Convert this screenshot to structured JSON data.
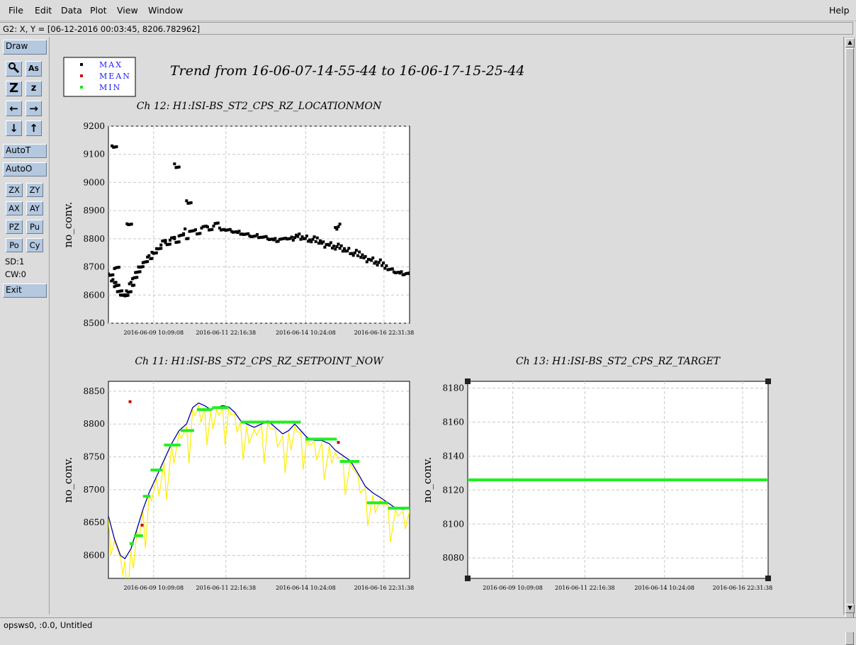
{
  "menu": {
    "file": "File",
    "edit": "Edit",
    "data": "Data",
    "plot": "Plot",
    "view": "View",
    "window": "Window",
    "help": "Help"
  },
  "status": {
    "coords": "G2: X, Y = [06-12-2016 00:03:45, 8206.782962]"
  },
  "toolbar": {
    "draw": "Draw",
    "autot": "AutoT",
    "autoo": "AutoO",
    "zx": "ZX",
    "zy": "ZY",
    "ax": "AX",
    "ay": "AY",
    "pz": "PZ",
    "pu": "Pu",
    "po": "Po",
    "cy": "Cy",
    "sd": "SD:1",
    "cw": "CW:0",
    "exit": "Exit",
    "icons": {
      "pointer": "magnify-icon",
      "text": "text-as-icon",
      "zoom_in": "zoom-in-z-icon",
      "zoom_out": "zoom-out-z-icon",
      "left": "left-arrow-icon",
      "right": "right-arrow-icon",
      "down": "down-arrow-icon",
      "up": "up-arrow-icon"
    }
  },
  "bottom": {
    "label": "opsws0, :0.0, Untitled"
  },
  "page": {
    "title": "Trend from 16-06-07-14-55-44 to 16-06-17-15-25-44",
    "legend": [
      {
        "label": "MAX",
        "color": "#000000"
      },
      {
        "label": "MEAN",
        "color": "#d00000"
      },
      {
        "label": "MIN",
        "color": "#20e020"
      }
    ],
    "colors": {
      "max": "#000000",
      "mean": "#d00000",
      "min": "#22ee22",
      "curve": "#0000a0",
      "band": "#ffee00"
    }
  },
  "chart_data": [
    {
      "type": "scatter",
      "title": "Ch 12: H1:ISI-BS_ST2_CPS_RZ_LOCATIONMON",
      "ylabel": "no_conv.",
      "xlabel": "",
      "ylim": [
        8500,
        9200
      ],
      "yticks": [
        "8500",
        "8600",
        "8700",
        "8800",
        "8900",
        "9000",
        "9100",
        "9200"
      ],
      "xticks": [
        "2016-06-09 10:09:08",
        "2016-06-11 22:16:38",
        "2016-06-14 10:24:08",
        "2016-06-16 22:31:38"
      ],
      "xrange_days": [
        0,
        10.02
      ],
      "grid": true,
      "series": [
        {
          "name": "MAX",
          "points": [
            [
              0.0,
              8675
            ],
            [
              0.1,
              8650
            ],
            [
              0.2,
              8630
            ],
            [
              0.3,
              8612
            ],
            [
              0.4,
              8600
            ],
            [
              0.5,
              8600
            ],
            [
              0.6,
              8615
            ],
            [
              0.7,
              8640
            ],
            [
              0.8,
              8658
            ],
            [
              0.9,
              8680
            ],
            [
              1.0,
              8700
            ],
            [
              1.15,
              8715
            ],
            [
              1.3,
              8735
            ],
            [
              1.45,
              8752
            ],
            [
              1.6,
              8765
            ],
            [
              1.75,
              8778
            ],
            [
              1.9,
              8786
            ],
            [
              2.05,
              8795
            ],
            [
              2.2,
              8800
            ],
            [
              2.35,
              8810
            ],
            [
              2.5,
              8818
            ],
            [
              2.7,
              8826
            ],
            [
              2.9,
              8832
            ],
            [
              3.1,
              8838
            ],
            [
              3.3,
              8842
            ],
            [
              3.5,
              8845
            ],
            [
              3.7,
              8838
            ],
            [
              3.9,
              8830
            ],
            [
              4.1,
              8826
            ],
            [
              4.3,
              8822
            ],
            [
              4.5,
              8815
            ],
            [
              4.7,
              8810
            ],
            [
              4.9,
              8810
            ],
            [
              5.1,
              8805
            ],
            [
              5.3,
              8800
            ],
            [
              5.5,
              8796
            ],
            [
              5.7,
              8798
            ],
            [
              5.9,
              8802
            ],
            [
              6.1,
              8806
            ],
            [
              6.3,
              8808
            ],
            [
              6.5,
              8800
            ],
            [
              6.7,
              8796
            ],
            [
              6.9,
              8790
            ],
            [
              7.1,
              8784
            ],
            [
              7.3,
              8780
            ],
            [
              7.5,
              8774
            ],
            [
              7.7,
              8766
            ],
            [
              7.9,
              8756
            ],
            [
              8.1,
              8748
            ],
            [
              8.3,
              8740
            ],
            [
              8.5,
              8732
            ],
            [
              8.7,
              8726
            ],
            [
              8.9,
              8718
            ],
            [
              9.1,
              8705
            ],
            [
              9.3,
              8690
            ],
            [
              9.5,
              8682
            ],
            [
              9.7,
              8678
            ],
            [
              9.9,
              8676
            ],
            [
              10.02,
              8676
            ],
            [
              0.12,
              9130
            ],
            [
              0.2,
              8694
            ],
            [
              0.62,
              8853
            ],
            [
              2.2,
              9066
            ],
            [
              2.6,
              8935
            ],
            [
              7.55,
              8840
            ]
          ]
        }
      ]
    },
    {
      "type": "line",
      "title": "Ch 11: H1:ISI-BS_ST2_CPS_RZ_SETPOINT_NOW",
      "ylabel": "no_conv.",
      "xlabel": "",
      "ylim": [
        8565,
        8865
      ],
      "yticks": [
        "8600",
        "8650",
        "8700",
        "8750",
        "8800",
        "8850"
      ],
      "xticks": [
        "2016-06-09 10:09:08",
        "2016-06-11 22:16:38",
        "2016-06-14 10:24:08",
        "2016-06-16 22:31:38"
      ],
      "xrange_days": [
        0,
        10.02
      ],
      "grid": true,
      "series": [
        {
          "name": "MEAN",
          "points": [
            [
              0.0,
              8660
            ],
            [
              0.2,
              8625
            ],
            [
              0.4,
              8600
            ],
            [
              0.55,
              8595
            ],
            [
              0.75,
              8610
            ],
            [
              0.95,
              8640
            ],
            [
              1.15,
              8670
            ],
            [
              1.35,
              8695
            ],
            [
              1.6,
              8720
            ],
            [
              1.85,
              8745
            ],
            [
              2.1,
              8770
            ],
            [
              2.35,
              8790
            ],
            [
              2.6,
              8800
            ],
            [
              2.8,
              8825
            ],
            [
              3.0,
              8832
            ],
            [
              3.2,
              8828
            ],
            [
              3.4,
              8822
            ],
            [
              3.6,
              8825
            ],
            [
              3.8,
              8828
            ],
            [
              4.0,
              8826
            ],
            [
              4.2,
              8818
            ],
            [
              4.4,
              8805
            ],
            [
              4.6,
              8800
            ],
            [
              4.85,
              8795
            ],
            [
              5.1,
              8800
            ],
            [
              5.3,
              8805
            ],
            [
              5.55,
              8795
            ],
            [
              5.8,
              8785
            ],
            [
              6.0,
              8790
            ],
            [
              6.2,
              8800
            ],
            [
              6.4,
              8790
            ],
            [
              6.6,
              8780
            ],
            [
              6.85,
              8775
            ],
            [
              7.1,
              8775
            ],
            [
              7.35,
              8770
            ],
            [
              7.55,
              8760
            ],
            [
              7.8,
              8752
            ],
            [
              8.05,
              8744
            ],
            [
              8.3,
              8725
            ],
            [
              8.55,
              8705
            ],
            [
              8.8,
              8695
            ],
            [
              9.05,
              8688
            ],
            [
              9.3,
              8680
            ],
            [
              9.55,
              8672
            ],
            [
              9.8,
              8670
            ],
            [
              10.02,
              8672
            ]
          ]
        },
        {
          "name": "MIN",
          "steps": [
            [
              0.7,
              0.85,
              8618
            ],
            [
              0.85,
              1.15,
              8630
            ],
            [
              1.15,
              1.4,
              8690
            ],
            [
              1.4,
              1.8,
              8730
            ],
            [
              1.85,
              2.4,
              8768
            ],
            [
              2.4,
              2.85,
              8790
            ],
            [
              2.95,
              3.45,
              8822
            ],
            [
              3.45,
              4.0,
              8825
            ],
            [
              4.4,
              6.4,
              8803
            ],
            [
              6.55,
              7.6,
              8777
            ],
            [
              7.7,
              8.35,
              8743
            ],
            [
              8.6,
              9.3,
              8680
            ],
            [
              9.3,
              10.02,
              8672
            ]
          ]
        },
        {
          "name": "MEAN-outliers",
          "points": [
            [
              0.72,
              8834
            ],
            [
              1.12,
              8646
            ],
            [
              7.65,
              8772
            ]
          ]
        }
      ]
    },
    {
      "type": "line",
      "title": "Ch 13: H1:ISI-BS_ST2_CPS_RZ_TARGET",
      "ylabel": "no_conv.",
      "xlabel": "",
      "ylim": [
        8068,
        8184
      ],
      "yticks": [
        "8080",
        "8100",
        "8120",
        "8140",
        "8160",
        "8180"
      ],
      "xticks": [
        "2016-06-09 10:09:08",
        "2016-06-11 22:16:38",
        "2016-06-14 10:24:08",
        "2016-06-16 22:31:38"
      ],
      "xrange_days": [
        0,
        10.02
      ],
      "grid": true,
      "series": [
        {
          "name": "MIN",
          "points": [
            [
              0,
              8126
            ],
            [
              10.02,
              8126
            ]
          ]
        }
      ]
    }
  ]
}
